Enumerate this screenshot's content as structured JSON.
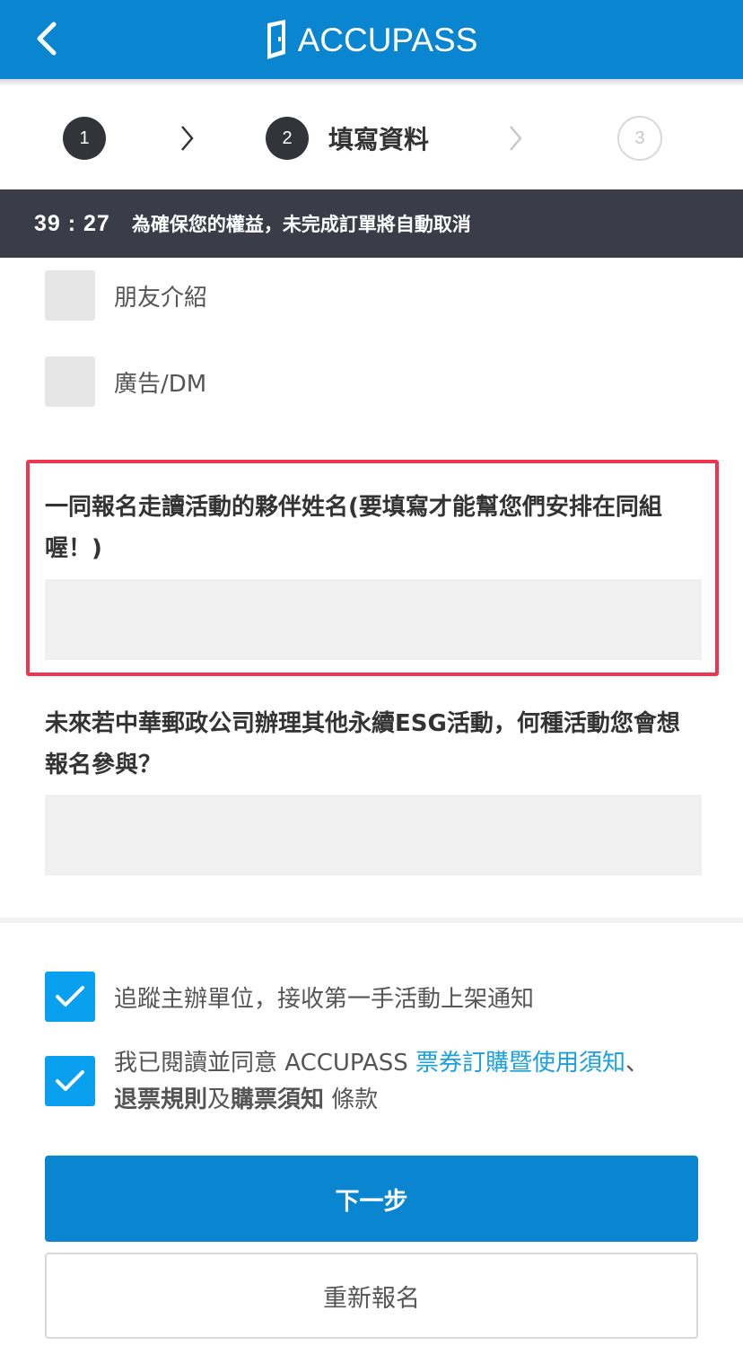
{
  "header": {
    "logo_text": "ACCUPASS",
    "back_icon": "chevron-left-icon",
    "color": "#0a86d0"
  },
  "steps": [
    {
      "number": "1",
      "state": "done"
    },
    {
      "number": "2",
      "state": "active",
      "label": "填寫資料"
    },
    {
      "number": "3",
      "state": "pending"
    }
  ],
  "timer": {
    "time": "39 : 27",
    "message": "為確保您的權益，未完成訂單將自動取消"
  },
  "source_options": [
    {
      "label": "朋友介紹",
      "checked": false
    },
    {
      "label": "廣告/DM",
      "checked": false
    }
  ],
  "questions": [
    {
      "label": "一同報名走讀活動的夥伴姓名(要填寫才能幫您們安排在同組喔！)",
      "value": "",
      "highlight_color": "#ef3650"
    },
    {
      "label": "未來若中華郵政公司辦理其他永續ESG活動，何種活動您會想報名參與？",
      "value": ""
    }
  ],
  "consent": {
    "follow_label": "追蹤主辦單位，接收第一手活動上架通知",
    "follow_checked": true,
    "terms_prefix": "我已閱讀並同意 ACCUPASS ",
    "terms_link": "票券訂購暨使用須知",
    "terms_sep": "、",
    "refund_link": "退票規則",
    "and_text": "及",
    "purchase_link": "購票須知",
    "terms_suffix": " 條款",
    "terms_checked": true,
    "check_color": "#0aa0f0",
    "link_color": "#1aa0dc"
  },
  "buttons": {
    "next_label": "下一步",
    "reset_label": "重新報名"
  }
}
